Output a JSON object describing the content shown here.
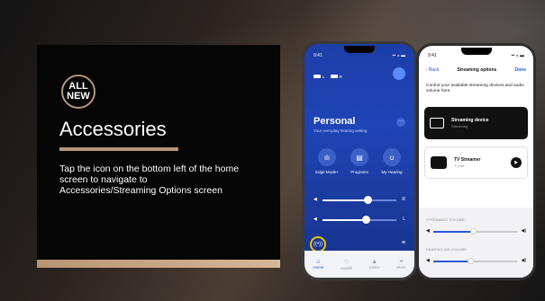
{
  "slide": {
    "badge_line1": "ALL",
    "badge_line2": "NEW",
    "title": "Accessories",
    "description": "Tap the icon on the bottom left of the home screen to navigate to Accessories/Streaming Options screen",
    "accent_color": "#b89474"
  },
  "phone1": {
    "time": "9:41",
    "hearing_aid_left": "L",
    "hearing_aid_right": "R",
    "program_name": "Personal",
    "program_subtitle": "Your everyday hearing setting",
    "quick_actions": [
      {
        "label": "Edge Mode+",
        "icon": "waveform-icon"
      },
      {
        "label": "Programs",
        "icon": "programs-icon"
      },
      {
        "label": "My Hearing",
        "icon": "ear-icon"
      }
    ],
    "volume_right": {
      "side": "R",
      "level": 0.62
    },
    "volume_left": {
      "side": "L",
      "level": 0.59
    },
    "tabs": [
      {
        "label": "Home",
        "icon": "home-icon",
        "active": true
      },
      {
        "label": "Health",
        "icon": "heart-icon",
        "active": false
      },
      {
        "label": "Learn",
        "icon": "graduation-cap-icon",
        "active": false
      },
      {
        "label": "More",
        "icon": "menu-icon",
        "active": false
      }
    ]
  },
  "phone2": {
    "time": "9:41",
    "back_label": "Back",
    "title": "Streaming options",
    "done_label": "Done",
    "description": "Control your available streaming devices and audio volume here.",
    "devices": [
      {
        "name": "Streaming device",
        "status": "Streaming",
        "icon": "device-icon"
      },
      {
        "name": "TV Streamer",
        "status": "Edit",
        "icon": "tv-streamer-icon"
      }
    ],
    "streaming_volume_label": "STREAMING VOLUME",
    "streaming_volume_level": 0.48,
    "hearing_aid_volume_label": "HEARING AID VOLUME",
    "hearing_aid_volume_level": 0.45
  }
}
